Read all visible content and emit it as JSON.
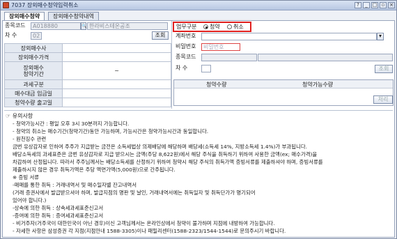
{
  "window": {
    "title": "7037 장외매수청약입력취소"
  },
  "tabs": [
    {
      "label": "장외매수청약"
    },
    {
      "label": "장외매수청약내역"
    }
  ],
  "left": {
    "stock_code_label": "종목코드",
    "stock_code_value": "A018880",
    "stock_name_value": "한라비스테온공조",
    "round_label": "차   수",
    "round_value": "02",
    "query_button": "조회",
    "info_rows": [
      {
        "label": "장외매수사",
        "value": ""
      },
      {
        "label": "장외매수가격",
        "value": ""
      },
      {
        "label": "장외매수\n청약기간",
        "value": "~"
      },
      {
        "label": "과세구분",
        "value": ""
      },
      {
        "label": "매수대금 입금일",
        "value": ""
      },
      {
        "label": "청약수량 출고일",
        "value": ""
      }
    ]
  },
  "right": {
    "work_type_label": "업무구분",
    "work_type_options": [
      {
        "label": "청약",
        "selected": true
      },
      {
        "label": "취소",
        "selected": false
      }
    ],
    "account_label": "계좌번호",
    "password_label": "비밀번호",
    "password_placeholder": "비밀번호",
    "stock_code_label": "종목코드",
    "round_label": "차   수",
    "query_button": "조회",
    "grid_headers": [
      "청약수량",
      "청약가능수량"
    ],
    "process_button": "처리"
  },
  "notes": {
    "heading": "유의사항",
    "lines": [
      "- 청약가능시간 : 평일 오후 3시 30분까지 가능합니다.",
      "- 청약의 취소는 매수기간(청약기간)동안 가능하며, 가능시간은 청약가능시간과 동일합니다.",
      "- 원천징수 관련",
      "  금번 유상감자로 인하여 주주가 지급받는 금전은 소득세법상 의제배당에 해당하며 배당세(소득세 14%, 지방소득세 1.4%)가 부과됩니다.",
      "  배당소득세의 과세표준은 금번 유상감자로 지급 받으시는 금액(주당 8,622원)에서 해당 주식을 취득하기 위하여 사용한 금액(ex; 매수가격)을",
      "  차감하여 산정됩니다. 따라서 주주님께서는 배당소득세를 산정하기 위하여 청약시 해당 주식의 취득가액 증빙서류를 제출하셔야 하며, 증빙서류를",
      "  제출하시지 않은 경우 취득가액은 주당 액면가액(5,000원)으로 간주됩니다.",
      "  ※ 증빙 서류",
      "   -매매를 통한 취득 : 거래내역서 및 매수일자별 잔고내역서",
      "                         (거래 증권사에서 발급받으셔야 하며, 발급지점의 명판 및 날인, 거래내역서에는 취득일자 및 취득단가가 명기되어",
      "                          있어야 합니다.)",
      "   -상속에 의한 취득 : 상속세과세표준신고서",
      "   -증여에 의한 취득 : 증여세과세표준신고서",
      "- 비거주자(거주국이 대한민국이 아닌 경우)이신 고객님께서는 온라인상에서 청약이 불가하며 지점에 내방하여 가능합니다.",
      "- 자세한 사항은 삼성증권 각 지점(지점안내 1588-3305)이나 패밀리센터(1588-2323/1544-1544)로 문의주시기 바랍니다."
    ]
  }
}
